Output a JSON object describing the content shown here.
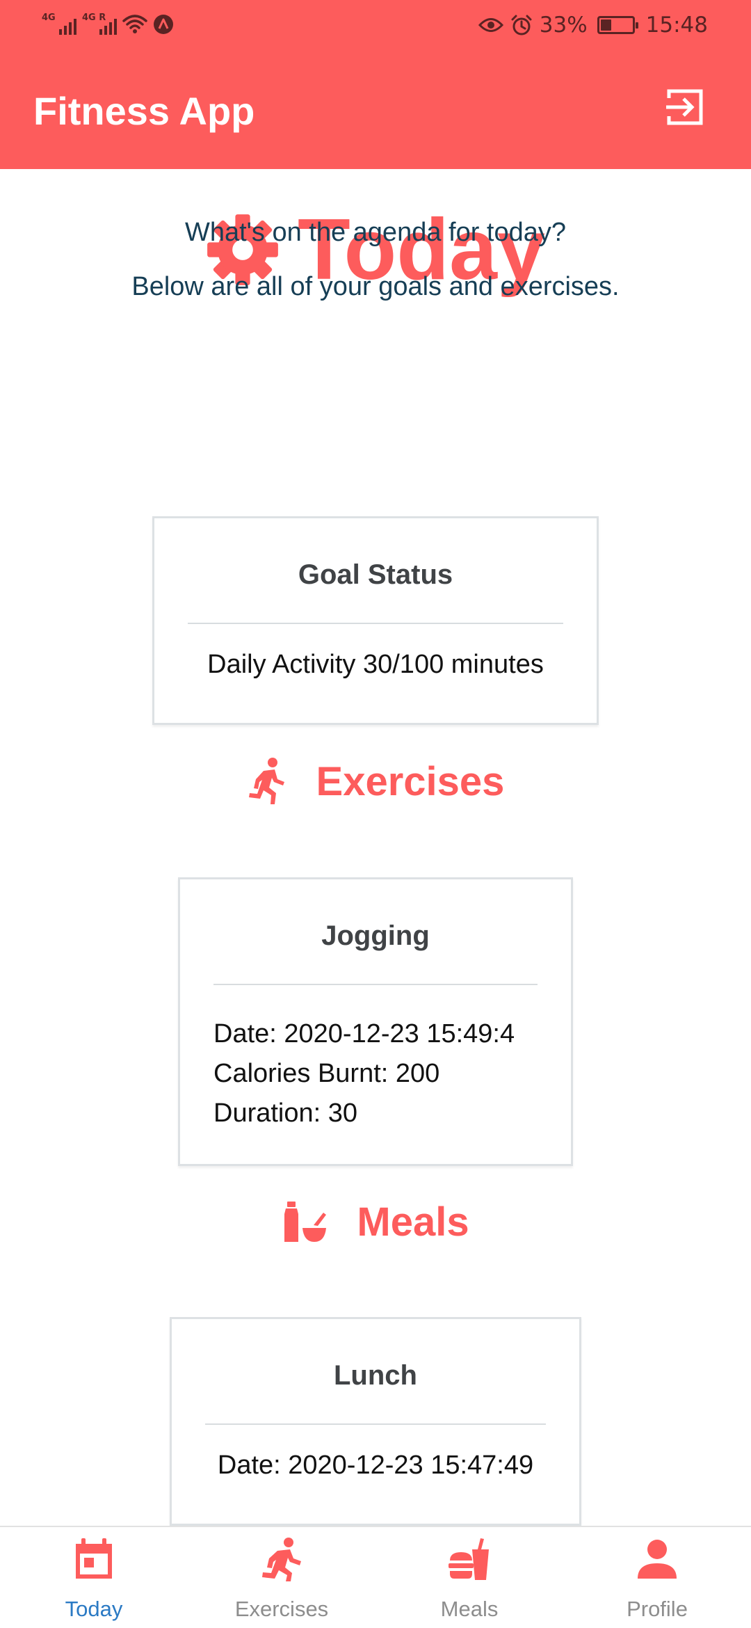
{
  "status_bar": {
    "signal1_label": "4G",
    "signal2_label": "4G R",
    "battery_percent": "33%",
    "battery_level": 0.33,
    "time": "15:48",
    "icons": [
      "wifi-icon",
      "notification-app-icon",
      "eye-icon",
      "alarm-icon"
    ]
  },
  "app_bar": {
    "title": "Fitness App",
    "logout_icon": "logout-icon"
  },
  "today": {
    "title": "Today",
    "icon": "gear-icon",
    "subtitle": "What's on the agenda for today?",
    "description": "Below are all of your goals and exercises."
  },
  "goal_card": {
    "title": "Goal Status",
    "text": "Daily Activity 30/100 minutes"
  },
  "exercises_section": {
    "title": "Exercises",
    "icon": "running-icon",
    "items": [
      {
        "title": "Jogging",
        "date": "Date: 2020-12-23 15:49:4",
        "calories": "Calories Burnt: 200",
        "duration": "Duration: 30"
      }
    ]
  },
  "meals_section": {
    "title": "Meals",
    "icon": "meal-icon",
    "items": [
      {
        "title": "Lunch",
        "date": "Date: 2020-12-23 15:47:49"
      }
    ]
  },
  "bottom_nav": {
    "items": [
      {
        "label": "Today",
        "icon": "calendar-icon",
        "active": true
      },
      {
        "label": "Exercises",
        "icon": "running-icon",
        "active": false
      },
      {
        "label": "Meals",
        "icon": "fastfood-icon",
        "active": false
      },
      {
        "label": "Profile",
        "icon": "person-icon",
        "active": false
      }
    ]
  },
  "colors": {
    "primary": "#fd5c5c",
    "heading_text": "#163e55",
    "active_nav": "#2b7ac4",
    "inactive_nav": "#8d8d8d"
  }
}
